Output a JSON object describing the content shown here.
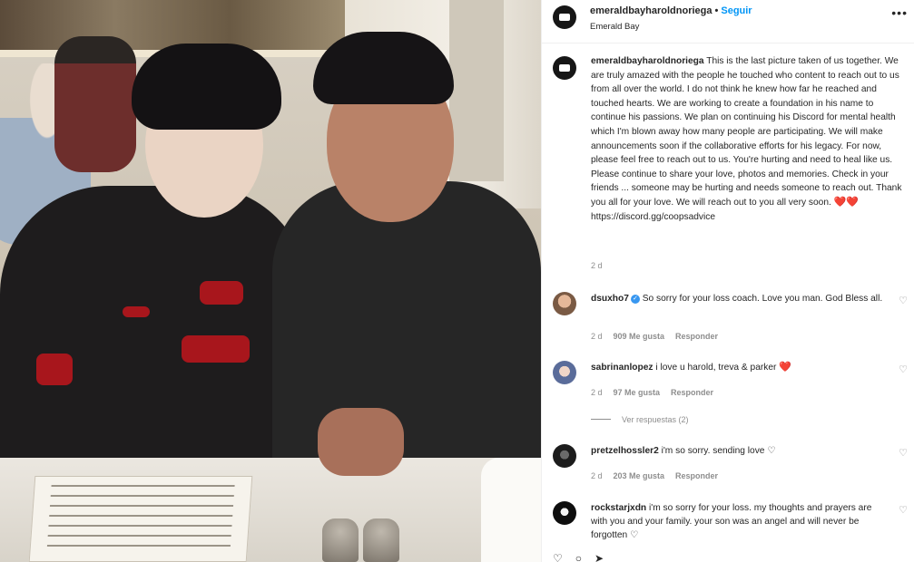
{
  "post": {
    "username": "emeraldbayharoldnoriega",
    "follow_label": "Seguir",
    "location": "Emerald Bay",
    "more_icon": "more-options-icon",
    "caption_user": "emeraldbayharoldnoriega",
    "caption_text": "This is the last picture taken of us together. We are truly amazed with the people he touched who content to reach out to us from all over the world. I do not think he knew how far he reached and touched hearts. We are working to create a foundation in his name to continue his passions. We plan on continuing his Discord for mental health which I'm blown away how many people are participating. We will make announcements soon if the collaborative efforts for his legacy. For now, please feel free to reach out to us. You're hurting and need to heal like us. Please continue to share your love, photos and memories. Check in your friends ... someone may be hurting and needs someone to reach out. Thank you all for your love. We will reach out to you all very soon.",
    "caption_hearts": "❤️❤️",
    "caption_link": "https://discord.gg/coopsadvice",
    "caption_time": "2 d"
  },
  "comments": [
    {
      "user": "dsuxho7",
      "verified": true,
      "text": "So sorry for your loss coach. Love you man. God Bless all.",
      "time": "2 d",
      "likes": "909 Me gusta",
      "reply": "Responder"
    },
    {
      "user": "sabrinanlopez",
      "verified": false,
      "text": "i love u harold, treva & parker",
      "heart": "❤️",
      "time": "2 d",
      "likes": "97 Me gusta",
      "reply": "Responder",
      "view_replies": "Ver respuestas (2)"
    },
    {
      "user": "pretzelhossler2",
      "verified": false,
      "text": "i'm so sorry. sending love",
      "heart": "♡",
      "time": "2 d",
      "likes": "203 Me gusta",
      "reply": "Responder"
    },
    {
      "user": "rockstarjxdn",
      "verified": false,
      "text": "i'm so sorry for your loss. my thoughts and prayers are with you and your family. your son was an angel and will never be forgotten",
      "heart": "♡"
    }
  ],
  "colors": {
    "accent_blue": "#0095f6",
    "heart_red": "#ed1c3a",
    "meta_gray": "#8e8e8e",
    "text_dark": "#262626"
  }
}
